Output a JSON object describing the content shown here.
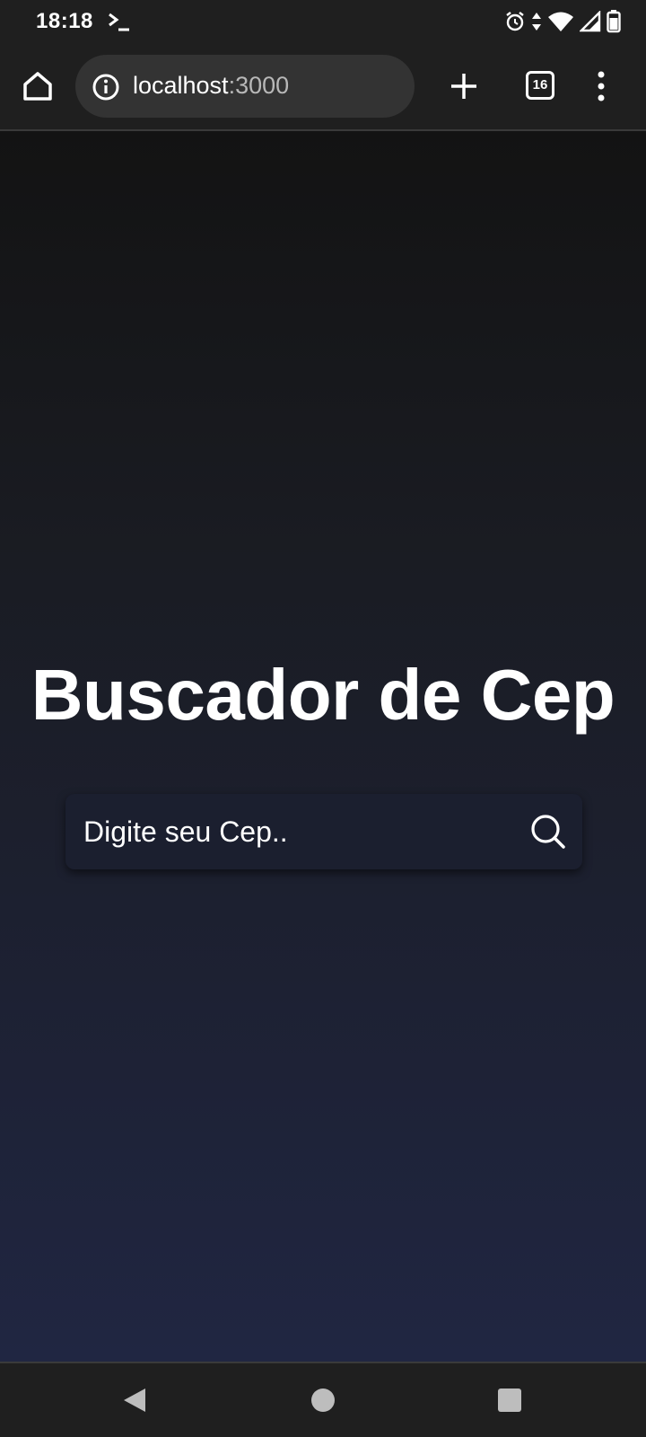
{
  "status_bar": {
    "time": "18:18",
    "icons": [
      "terminal-icon",
      "alarm-icon",
      "data-arrows-icon",
      "wifi-icon",
      "signal-icon",
      "battery-icon"
    ]
  },
  "browser": {
    "url_host": "localhost",
    "url_port": ":3000",
    "tab_count": "16",
    "icons": [
      "home-icon",
      "info-icon",
      "plus-icon",
      "tabs-icon",
      "more-vertical-icon"
    ]
  },
  "page": {
    "title": "Buscador de Cep",
    "search": {
      "placeholder": "Digite seu Cep..",
      "value": "",
      "icon": "search-icon"
    }
  },
  "nav_bar": {
    "icons": [
      "back-icon",
      "home-circle-icon",
      "recents-icon"
    ]
  },
  "colors": {
    "chrome_bg": "#1f1f1f",
    "url_bar_bg": "#333333",
    "page_gradient_top": "#131313",
    "page_gradient_bottom": "#202642",
    "search_box_bg": "#1b1f2f",
    "text": "#ffffff"
  }
}
